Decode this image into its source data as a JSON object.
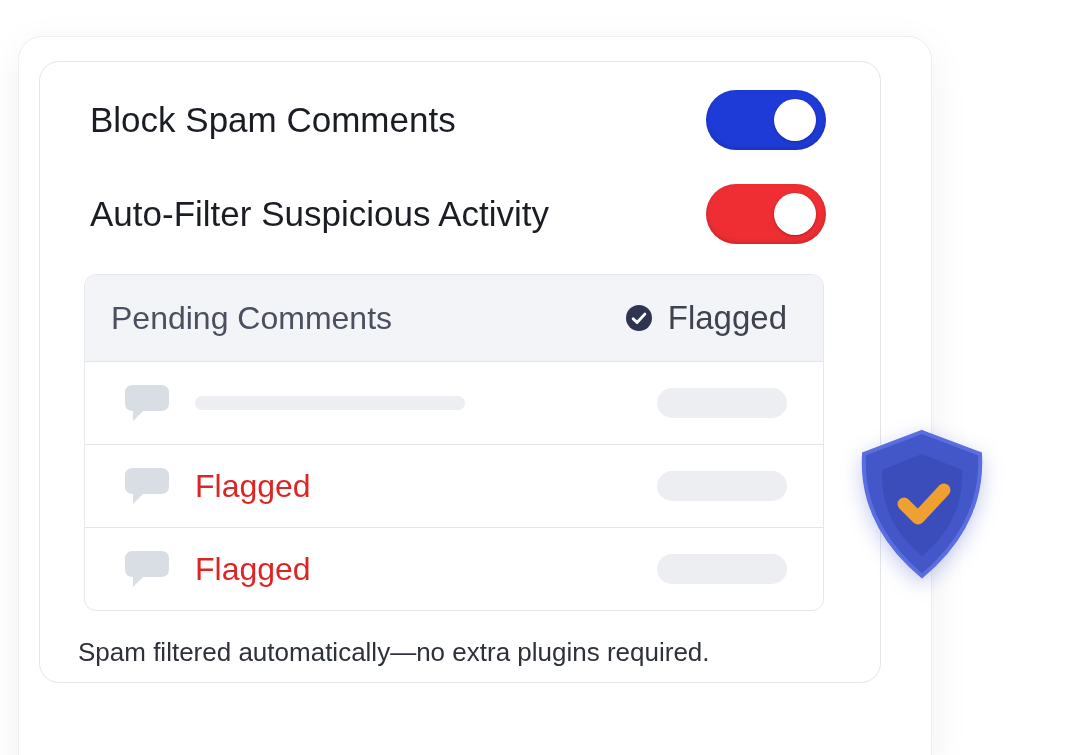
{
  "settings": [
    {
      "label": "Block Spam Comments",
      "on": true,
      "color": "#1e3bd8"
    },
    {
      "label": "Auto-Filter Suspicious Activity",
      "on": true,
      "color": "#ee2e33"
    }
  ],
  "pending": {
    "title": "Pending Comments",
    "filter_label": "Flagged",
    "filter_checked": true,
    "rows": [
      {
        "kind": "skeleton"
      },
      {
        "kind": "flagged",
        "label": "Flagged"
      },
      {
        "kind": "flagged",
        "label": "Flagged"
      }
    ]
  },
  "footer": "Spam filtered automatically—no extra plugins required."
}
